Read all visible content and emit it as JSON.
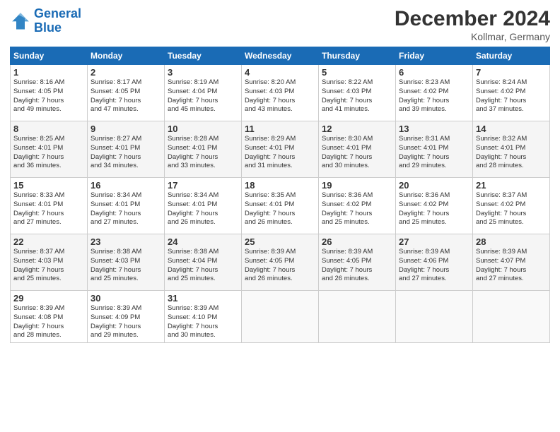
{
  "logo": {
    "line1": "General",
    "line2": "Blue"
  },
  "title": "December 2024",
  "location": "Kollmar, Germany",
  "weekdays": [
    "Sunday",
    "Monday",
    "Tuesday",
    "Wednesday",
    "Thursday",
    "Friday",
    "Saturday"
  ],
  "weeks": [
    [
      {
        "day": "1",
        "sunrise": "8:16 AM",
        "sunset": "4:05 PM",
        "daylight": "7 hours and 49 minutes."
      },
      {
        "day": "2",
        "sunrise": "8:17 AM",
        "sunset": "4:05 PM",
        "daylight": "7 hours and 47 minutes."
      },
      {
        "day": "3",
        "sunrise": "8:19 AM",
        "sunset": "4:04 PM",
        "daylight": "7 hours and 45 minutes."
      },
      {
        "day": "4",
        "sunrise": "8:20 AM",
        "sunset": "4:03 PM",
        "daylight": "7 hours and 43 minutes."
      },
      {
        "day": "5",
        "sunrise": "8:22 AM",
        "sunset": "4:03 PM",
        "daylight": "7 hours and 41 minutes."
      },
      {
        "day": "6",
        "sunrise": "8:23 AM",
        "sunset": "4:02 PM",
        "daylight": "7 hours and 39 minutes."
      },
      {
        "day": "7",
        "sunrise": "8:24 AM",
        "sunset": "4:02 PM",
        "daylight": "7 hours and 37 minutes."
      }
    ],
    [
      {
        "day": "8",
        "sunrise": "8:25 AM",
        "sunset": "4:01 PM",
        "daylight": "7 hours and 36 minutes."
      },
      {
        "day": "9",
        "sunrise": "8:27 AM",
        "sunset": "4:01 PM",
        "daylight": "7 hours and 34 minutes."
      },
      {
        "day": "10",
        "sunrise": "8:28 AM",
        "sunset": "4:01 PM",
        "daylight": "7 hours and 33 minutes."
      },
      {
        "day": "11",
        "sunrise": "8:29 AM",
        "sunset": "4:01 PM",
        "daylight": "7 hours and 31 minutes."
      },
      {
        "day": "12",
        "sunrise": "8:30 AM",
        "sunset": "4:01 PM",
        "daylight": "7 hours and 30 minutes."
      },
      {
        "day": "13",
        "sunrise": "8:31 AM",
        "sunset": "4:01 PM",
        "daylight": "7 hours and 29 minutes."
      },
      {
        "day": "14",
        "sunrise": "8:32 AM",
        "sunset": "4:01 PM",
        "daylight": "7 hours and 28 minutes."
      }
    ],
    [
      {
        "day": "15",
        "sunrise": "8:33 AM",
        "sunset": "4:01 PM",
        "daylight": "7 hours and 27 minutes."
      },
      {
        "day": "16",
        "sunrise": "8:34 AM",
        "sunset": "4:01 PM",
        "daylight": "7 hours and 27 minutes."
      },
      {
        "day": "17",
        "sunrise": "8:34 AM",
        "sunset": "4:01 PM",
        "daylight": "7 hours and 26 minutes."
      },
      {
        "day": "18",
        "sunrise": "8:35 AM",
        "sunset": "4:01 PM",
        "daylight": "7 hours and 26 minutes."
      },
      {
        "day": "19",
        "sunrise": "8:36 AM",
        "sunset": "4:02 PM",
        "daylight": "7 hours and 25 minutes."
      },
      {
        "day": "20",
        "sunrise": "8:36 AM",
        "sunset": "4:02 PM",
        "daylight": "7 hours and 25 minutes."
      },
      {
        "day": "21",
        "sunrise": "8:37 AM",
        "sunset": "4:02 PM",
        "daylight": "7 hours and 25 minutes."
      }
    ],
    [
      {
        "day": "22",
        "sunrise": "8:37 AM",
        "sunset": "4:03 PM",
        "daylight": "7 hours and 25 minutes."
      },
      {
        "day": "23",
        "sunrise": "8:38 AM",
        "sunset": "4:03 PM",
        "daylight": "7 hours and 25 minutes."
      },
      {
        "day": "24",
        "sunrise": "8:38 AM",
        "sunset": "4:04 PM",
        "daylight": "7 hours and 25 minutes."
      },
      {
        "day": "25",
        "sunrise": "8:39 AM",
        "sunset": "4:05 PM",
        "daylight": "7 hours and 26 minutes."
      },
      {
        "day": "26",
        "sunrise": "8:39 AM",
        "sunset": "4:05 PM",
        "daylight": "7 hours and 26 minutes."
      },
      {
        "day": "27",
        "sunrise": "8:39 AM",
        "sunset": "4:06 PM",
        "daylight": "7 hours and 27 minutes."
      },
      {
        "day": "28",
        "sunrise": "8:39 AM",
        "sunset": "4:07 PM",
        "daylight": "7 hours and 27 minutes."
      }
    ],
    [
      {
        "day": "29",
        "sunrise": "8:39 AM",
        "sunset": "4:08 PM",
        "daylight": "7 hours and 28 minutes."
      },
      {
        "day": "30",
        "sunrise": "8:39 AM",
        "sunset": "4:09 PM",
        "daylight": "7 hours and 29 minutes."
      },
      {
        "day": "31",
        "sunrise": "8:39 AM",
        "sunset": "4:10 PM",
        "daylight": "7 hours and 30 minutes."
      },
      null,
      null,
      null,
      null
    ]
  ]
}
